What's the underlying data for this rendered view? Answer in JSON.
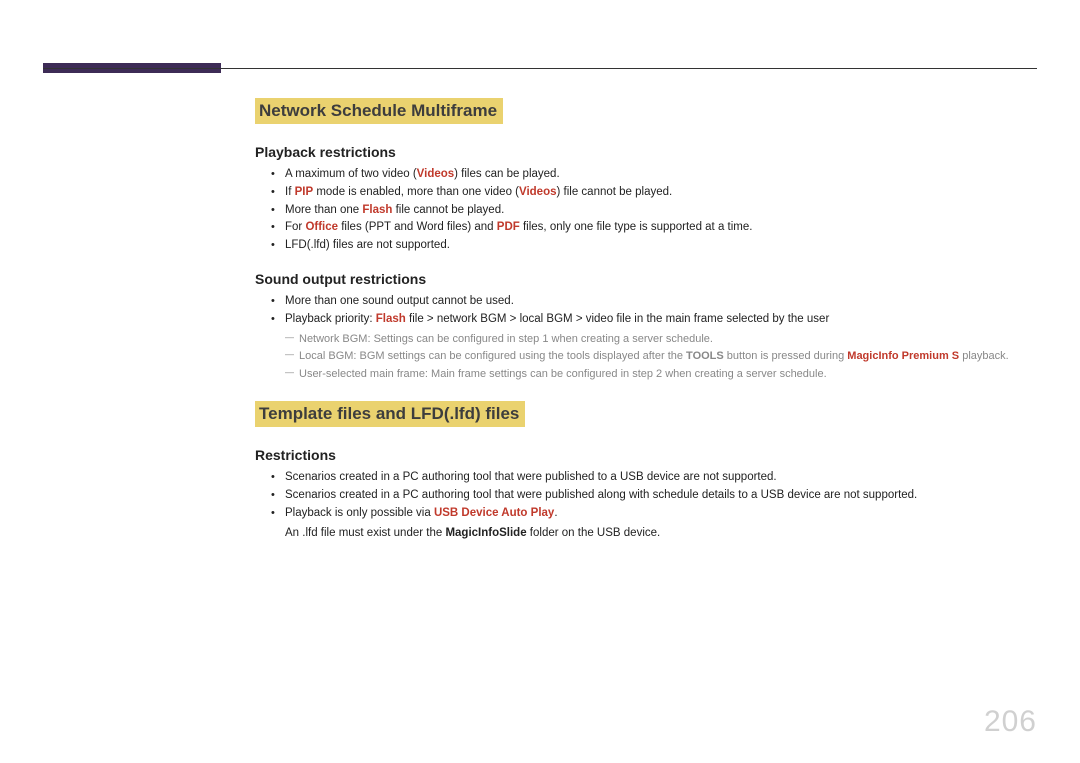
{
  "page_number": "206",
  "section1": {
    "heading": "Network Schedule Multiframe",
    "sub1": {
      "heading": "Playback restrictions",
      "b1": {
        "pre": "A maximum of two video (",
        "hl": "Videos",
        "post": ") files can be played."
      },
      "b2": {
        "pre": "If ",
        "hl1": "PIP",
        "mid": " mode is enabled, more than one video (",
        "hl2": "Videos",
        "post": ") file cannot be played."
      },
      "b3": {
        "pre": "More than one ",
        "hl": "Flash",
        "post": " file cannot be played."
      },
      "b4": {
        "pre": "For ",
        "hl1": "Office",
        "mid": " files (PPT and Word files) and ",
        "hl2": "PDF",
        "post": " files, only one file type is supported at a time."
      },
      "b5": {
        "text": "LFD(.lfd) files are not supported."
      }
    },
    "sub2": {
      "heading": "Sound output restrictions",
      "b1": {
        "text": "More than one sound output cannot be used."
      },
      "b2": {
        "pre": "Playback priority: ",
        "hl": "Flash",
        "post": " file > network BGM > local BGM > video file in the main frame selected by the user"
      },
      "d1": {
        "text": "Network BGM: Settings can be configured in step 1 when creating a server schedule."
      },
      "d2": {
        "pre": "Local BGM: BGM settings can be configured using the tools displayed after the ",
        "bold": "TOOLS",
        "mid": " button is pressed during ",
        "hl": "MagicInfo Premium S",
        "post": " playback."
      },
      "d3": {
        "text": "User-selected main frame: Main frame settings can be configured in step 2 when creating a server schedule."
      }
    }
  },
  "section2": {
    "heading": "Template files and LFD(.lfd) files",
    "sub1": {
      "heading": "Restrictions",
      "b1": {
        "text": "Scenarios created in a PC authoring tool that were published to a USB device are not supported."
      },
      "b2": {
        "text": "Scenarios created in a PC authoring tool that were published along with schedule details to a USB device are not supported."
      },
      "b3": {
        "pre": "Playback is only possible via ",
        "hl": "USB Device Auto Play",
        "post": "."
      },
      "note": {
        "pre": "An .lfd file must exist under the ",
        "bold": "MagicInfoSlide",
        "post": " folder on the USB device."
      }
    }
  }
}
